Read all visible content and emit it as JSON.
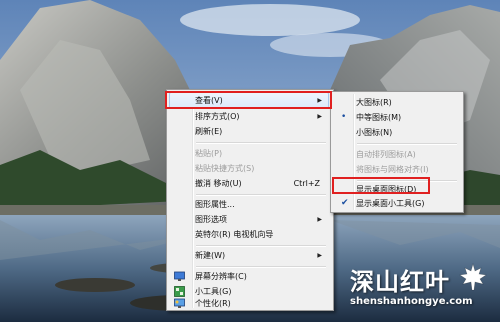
{
  "context_menu": {
    "items": [
      {
        "label": "查看(V)",
        "shortcut": "",
        "submenu": true,
        "disabled": false,
        "highlight": true
      },
      {
        "label": "排序方式(O)",
        "shortcut": "",
        "submenu": true,
        "disabled": false
      },
      {
        "label": "刷新(E)",
        "shortcut": "",
        "submenu": false,
        "disabled": false
      },
      {
        "label": "粘贴(P)",
        "shortcut": "",
        "submenu": false,
        "disabled": true
      },
      {
        "label": "粘贴快捷方式(S)",
        "shortcut": "",
        "submenu": false,
        "disabled": true
      },
      {
        "label": "撤消 移动(U)",
        "shortcut": "Ctrl+Z",
        "submenu": false,
        "disabled": false
      },
      {
        "label": "图形属性...",
        "shortcut": "",
        "submenu": false,
        "disabled": false
      },
      {
        "label": "图形选项",
        "shortcut": "",
        "submenu": true,
        "disabled": false
      },
      {
        "label": "英特尔(R) 电视机向导",
        "shortcut": "",
        "submenu": false,
        "disabled": false
      },
      {
        "label": "新建(W)",
        "shortcut": "",
        "submenu": true,
        "disabled": false
      },
      {
        "label": "屏幕分辨率(C)",
        "shortcut": "",
        "submenu": false,
        "disabled": false,
        "icon": "display-resolution-icon"
      },
      {
        "label": "小工具(G)",
        "shortcut": "",
        "submenu": false,
        "disabled": false,
        "icon": "gadgets-icon"
      },
      {
        "label": "个性化(R)",
        "shortcut": "",
        "submenu": false,
        "disabled": false,
        "icon": "personalize-icon"
      }
    ]
  },
  "view_submenu": {
    "items": [
      {
        "label": "大图标(R)",
        "mark": ""
      },
      {
        "label": "中等图标(M)",
        "mark": "•"
      },
      {
        "label": "小图标(N)",
        "mark": ""
      },
      {
        "label": "自动排列图标(A)",
        "mark": "",
        "disabled": true
      },
      {
        "label": "将图标与网格对齐(I)",
        "mark": "",
        "disabled": true
      },
      {
        "label": "显示桌面图标(D)",
        "mark": "",
        "highlight_box": true
      },
      {
        "label": "显示桌面小工具(G)",
        "mark": "✔"
      }
    ]
  },
  "watermark": {
    "logo_text": "深山红叶",
    "url": "shenshanhongye.com"
  },
  "colors": {
    "highlight_box": "#e02020",
    "menu_bg": "#f0f0f0",
    "radio_check": "#1a4ea0"
  }
}
